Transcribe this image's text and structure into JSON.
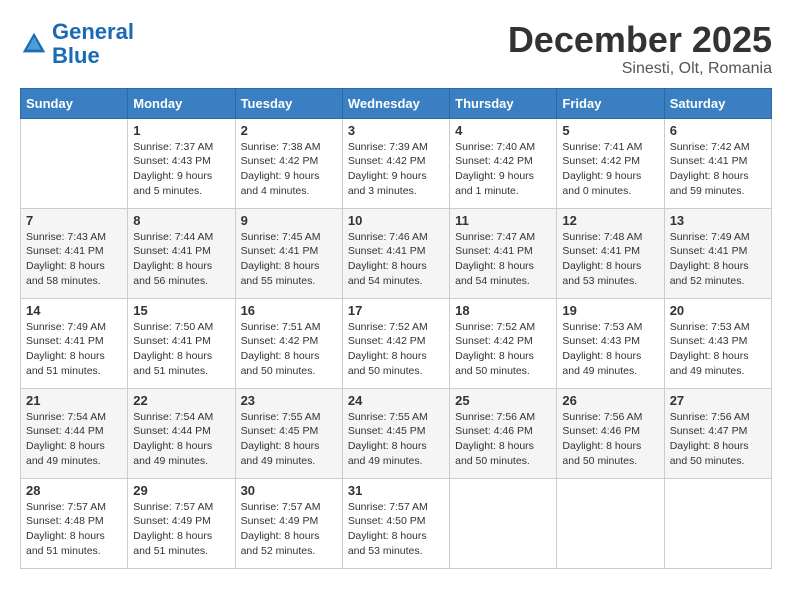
{
  "header": {
    "logo_line1": "General",
    "logo_line2": "Blue",
    "month_title": "December 2025",
    "location": "Sinesti, Olt, Romania"
  },
  "weekdays": [
    "Sunday",
    "Monday",
    "Tuesday",
    "Wednesday",
    "Thursday",
    "Friday",
    "Saturday"
  ],
  "weeks": [
    [
      {
        "day": "",
        "info": ""
      },
      {
        "day": "1",
        "info": "Sunrise: 7:37 AM\nSunset: 4:43 PM\nDaylight: 9 hours\nand 5 minutes."
      },
      {
        "day": "2",
        "info": "Sunrise: 7:38 AM\nSunset: 4:42 PM\nDaylight: 9 hours\nand 4 minutes."
      },
      {
        "day": "3",
        "info": "Sunrise: 7:39 AM\nSunset: 4:42 PM\nDaylight: 9 hours\nand 3 minutes."
      },
      {
        "day": "4",
        "info": "Sunrise: 7:40 AM\nSunset: 4:42 PM\nDaylight: 9 hours\nand 1 minute."
      },
      {
        "day": "5",
        "info": "Sunrise: 7:41 AM\nSunset: 4:42 PM\nDaylight: 9 hours\nand 0 minutes."
      },
      {
        "day": "6",
        "info": "Sunrise: 7:42 AM\nSunset: 4:41 PM\nDaylight: 8 hours\nand 59 minutes."
      }
    ],
    [
      {
        "day": "7",
        "info": "Sunrise: 7:43 AM\nSunset: 4:41 PM\nDaylight: 8 hours\nand 58 minutes."
      },
      {
        "day": "8",
        "info": "Sunrise: 7:44 AM\nSunset: 4:41 PM\nDaylight: 8 hours\nand 56 minutes."
      },
      {
        "day": "9",
        "info": "Sunrise: 7:45 AM\nSunset: 4:41 PM\nDaylight: 8 hours\nand 55 minutes."
      },
      {
        "day": "10",
        "info": "Sunrise: 7:46 AM\nSunset: 4:41 PM\nDaylight: 8 hours\nand 54 minutes."
      },
      {
        "day": "11",
        "info": "Sunrise: 7:47 AM\nSunset: 4:41 PM\nDaylight: 8 hours\nand 54 minutes."
      },
      {
        "day": "12",
        "info": "Sunrise: 7:48 AM\nSunset: 4:41 PM\nDaylight: 8 hours\nand 53 minutes."
      },
      {
        "day": "13",
        "info": "Sunrise: 7:49 AM\nSunset: 4:41 PM\nDaylight: 8 hours\nand 52 minutes."
      }
    ],
    [
      {
        "day": "14",
        "info": "Sunrise: 7:49 AM\nSunset: 4:41 PM\nDaylight: 8 hours\nand 51 minutes."
      },
      {
        "day": "15",
        "info": "Sunrise: 7:50 AM\nSunset: 4:41 PM\nDaylight: 8 hours\nand 51 minutes."
      },
      {
        "day": "16",
        "info": "Sunrise: 7:51 AM\nSunset: 4:42 PM\nDaylight: 8 hours\nand 50 minutes."
      },
      {
        "day": "17",
        "info": "Sunrise: 7:52 AM\nSunset: 4:42 PM\nDaylight: 8 hours\nand 50 minutes."
      },
      {
        "day": "18",
        "info": "Sunrise: 7:52 AM\nSunset: 4:42 PM\nDaylight: 8 hours\nand 50 minutes."
      },
      {
        "day": "19",
        "info": "Sunrise: 7:53 AM\nSunset: 4:43 PM\nDaylight: 8 hours\nand 49 minutes."
      },
      {
        "day": "20",
        "info": "Sunrise: 7:53 AM\nSunset: 4:43 PM\nDaylight: 8 hours\nand 49 minutes."
      }
    ],
    [
      {
        "day": "21",
        "info": "Sunrise: 7:54 AM\nSunset: 4:44 PM\nDaylight: 8 hours\nand 49 minutes."
      },
      {
        "day": "22",
        "info": "Sunrise: 7:54 AM\nSunset: 4:44 PM\nDaylight: 8 hours\nand 49 minutes."
      },
      {
        "day": "23",
        "info": "Sunrise: 7:55 AM\nSunset: 4:45 PM\nDaylight: 8 hours\nand 49 minutes."
      },
      {
        "day": "24",
        "info": "Sunrise: 7:55 AM\nSunset: 4:45 PM\nDaylight: 8 hours\nand 49 minutes."
      },
      {
        "day": "25",
        "info": "Sunrise: 7:56 AM\nSunset: 4:46 PM\nDaylight: 8 hours\nand 50 minutes."
      },
      {
        "day": "26",
        "info": "Sunrise: 7:56 AM\nSunset: 4:46 PM\nDaylight: 8 hours\nand 50 minutes."
      },
      {
        "day": "27",
        "info": "Sunrise: 7:56 AM\nSunset: 4:47 PM\nDaylight: 8 hours\nand 50 minutes."
      }
    ],
    [
      {
        "day": "28",
        "info": "Sunrise: 7:57 AM\nSunset: 4:48 PM\nDaylight: 8 hours\nand 51 minutes."
      },
      {
        "day": "29",
        "info": "Sunrise: 7:57 AM\nSunset: 4:49 PM\nDaylight: 8 hours\nand 51 minutes."
      },
      {
        "day": "30",
        "info": "Sunrise: 7:57 AM\nSunset: 4:49 PM\nDaylight: 8 hours\nand 52 minutes."
      },
      {
        "day": "31",
        "info": "Sunrise: 7:57 AM\nSunset: 4:50 PM\nDaylight: 8 hours\nand 53 minutes."
      },
      {
        "day": "",
        "info": ""
      },
      {
        "day": "",
        "info": ""
      },
      {
        "day": "",
        "info": ""
      }
    ]
  ]
}
